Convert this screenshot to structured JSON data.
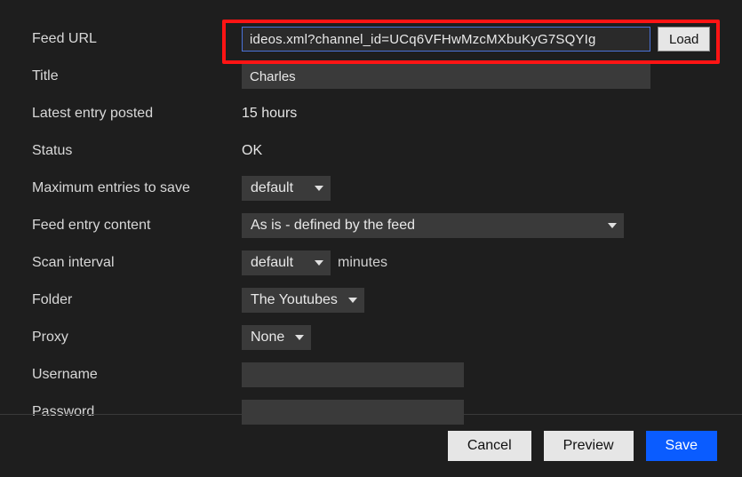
{
  "labels": {
    "feed_url": "Feed URL",
    "title": "Title",
    "latest_entry": "Latest entry posted",
    "status": "Status",
    "max_entries": "Maximum entries to save",
    "feed_content": "Feed entry content",
    "scan_interval": "Scan interval",
    "folder": "Folder",
    "proxy": "Proxy",
    "username": "Username",
    "password": "Password"
  },
  "values": {
    "feed_url": "ideos.xml?channel_id=UCq6VFHwMzcMXbuKyG7SQYIg",
    "title": "Charles",
    "latest_entry": "15 hours",
    "status": "OK",
    "max_entries": "default",
    "feed_content": "As is - defined by the feed",
    "scan_interval": "default",
    "scan_interval_suffix": "minutes",
    "folder": "The Youtubes",
    "proxy": "None",
    "username": "",
    "password": ""
  },
  "buttons": {
    "load": "Load",
    "cancel": "Cancel",
    "preview": "Preview",
    "save": "Save"
  },
  "highlight": true
}
